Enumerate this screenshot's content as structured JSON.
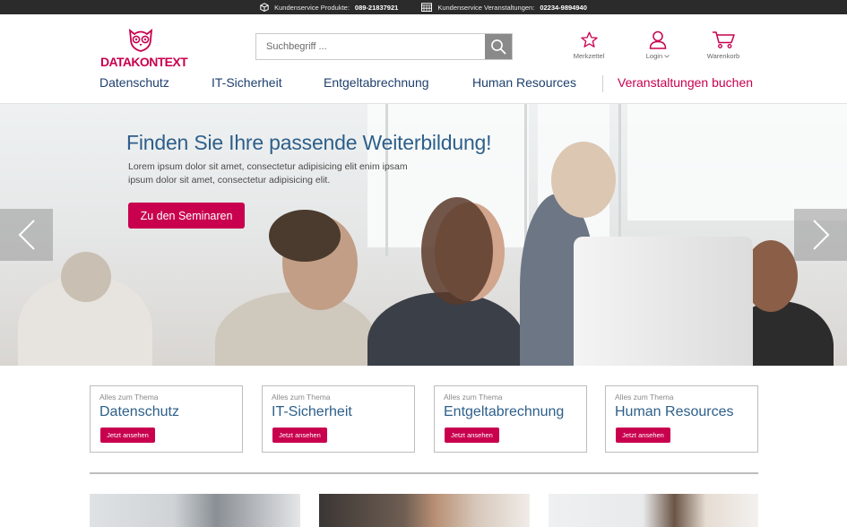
{
  "topbar": {
    "products_prefix": "Kundenservice Produkte:",
    "products_phone": "089-21837921",
    "events_prefix": "Kundenservice Veranstaltungen:",
    "events_phone": "02234-9894940"
  },
  "logo": {
    "text": "DATAKONTEXT"
  },
  "search": {
    "placeholder": "Suchbegriff ..."
  },
  "header_icons": {
    "wishlist": "Merkzettel",
    "login": "Login",
    "cart": "Warenkorb"
  },
  "nav": {
    "items": [
      "Datenschutz",
      "IT-Sicherheit",
      "Entgeltabrechnung",
      "Human Resources"
    ],
    "highlight": "Veranstaltungen buchen"
  },
  "hero": {
    "title": "Finden Sie Ihre passende Weiterbildung!",
    "text": "Lorem ipsum dolor sit amet, consectetur adipisicing elit enim ipsam ipsum dolor sit amet, consectetur adipisicing elit.",
    "cta": "Zu den Seminaren"
  },
  "topics": [
    {
      "pre": "Alles zum Thema",
      "title": "Datenschutz",
      "button": "Jetzt ansehen"
    },
    {
      "pre": "Alles zum Thema",
      "title": "IT-Sicherheit",
      "button": "Jetzt ansehen"
    },
    {
      "pre": "Alles zum Thema",
      "title": "Entgeltabrechnung",
      "button": "Jetzt ansehen"
    },
    {
      "pre": "Alles zum Thema",
      "title": "Human Resources",
      "button": "Jetzt ansehen"
    }
  ],
  "colors": {
    "brand": "#c8004e",
    "navy": "#1d3f6e",
    "heading_blue": "#2d5f8a",
    "topbar": "#2b2b2b"
  },
  "icons": [
    "box-icon",
    "calendar-icon",
    "search-icon",
    "star-icon",
    "user-icon",
    "chevron-down-icon",
    "cart-icon",
    "arrow-left-icon",
    "arrow-right-icon",
    "owl-logo-icon"
  ]
}
